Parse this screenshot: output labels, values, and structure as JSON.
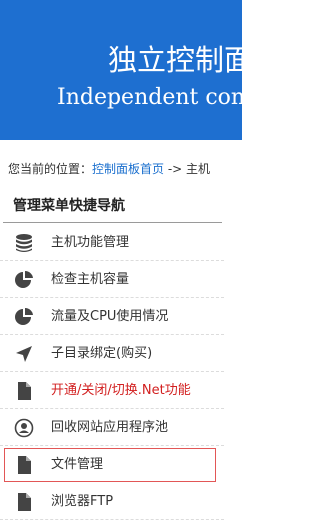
{
  "banner": {
    "title_cn": "独立控制面",
    "title_en": "Independent cont"
  },
  "breadcrumb": {
    "prefix": "您当前的位置：",
    "link": "控制面板首页",
    "separator": " -> ",
    "current": "主机"
  },
  "menu": {
    "title": "管理菜单快捷导航",
    "items": [
      {
        "label": "主机功能管理",
        "icon": "database-icon"
      },
      {
        "label": "检查主机容量",
        "icon": "pie-chart-icon"
      },
      {
        "label": "流量及CPU使用情况",
        "icon": "pie-chart-icon"
      },
      {
        "label": "子目录绑定(购买)",
        "icon": "send-arrow-icon"
      },
      {
        "label": "开通/关闭/切换.Net功能",
        "icon": "file-icon",
        "color": "#d21f1f"
      },
      {
        "label": "回收网站应用程序池",
        "icon": "user-circle-icon"
      },
      {
        "label": "文件管理",
        "icon": "file-icon",
        "selected": true
      },
      {
        "label": "浏览器FTP",
        "icon": "file-icon"
      }
    ]
  }
}
